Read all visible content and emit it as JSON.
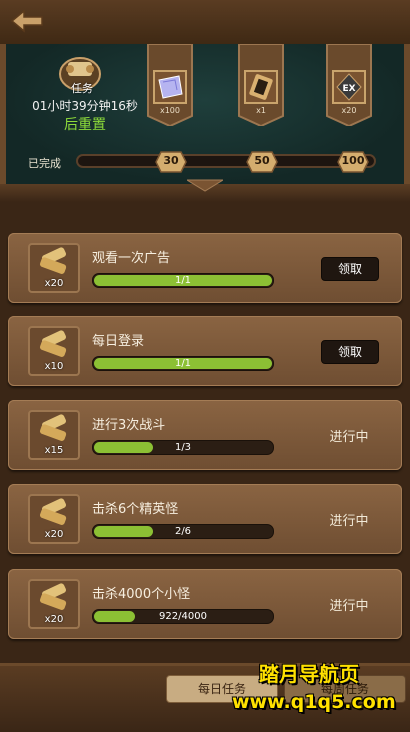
{
  "header": {
    "reset_icon_label": "任务",
    "reset_timer": "01小时39分钟16秒",
    "reset_suffix": "后重置",
    "rewards": [
      {
        "icon": "crystal-icon",
        "count": "x100"
      },
      {
        "icon": "scroll-icon",
        "count": "x1"
      },
      {
        "icon": "ex-card-icon",
        "count": "x20",
        "badge": "EX"
      }
    ],
    "completed_label": "已完成",
    "milestones": [
      "30",
      "50",
      "100"
    ],
    "progress": 0
  },
  "tasks": [
    {
      "title": "观看一次广告",
      "reward_count": "x20",
      "progress_text": "1/1",
      "progress": 1.0,
      "action": "领取",
      "state": "claim"
    },
    {
      "title": "每日登录",
      "reward_count": "x10",
      "progress_text": "1/1",
      "progress": 1.0,
      "action": "领取",
      "state": "claim"
    },
    {
      "title": "进行3次战斗",
      "reward_count": "x15",
      "progress_text": "1/3",
      "progress": 0.333,
      "action": "进行中",
      "state": "in-progress"
    },
    {
      "title": "击杀6个精英怪",
      "reward_count": "x20",
      "progress_text": "2/6",
      "progress": 0.333,
      "action": "进行中",
      "state": "in-progress"
    },
    {
      "title": "击杀4000个小怪",
      "reward_count": "x20",
      "progress_text": "922/4000",
      "progress": 0.23,
      "action": "进行中",
      "state": "in-progress"
    }
  ],
  "tabs": {
    "daily": "每日任务",
    "weekly": "每周任务"
  },
  "watermark": {
    "line1": "踏月导航页",
    "line2": "www.q1q5.com"
  },
  "colors": {
    "progress_fill": "#8cc034",
    "reset_suffix": "#8edc3a",
    "watermark": "#ffe100"
  }
}
